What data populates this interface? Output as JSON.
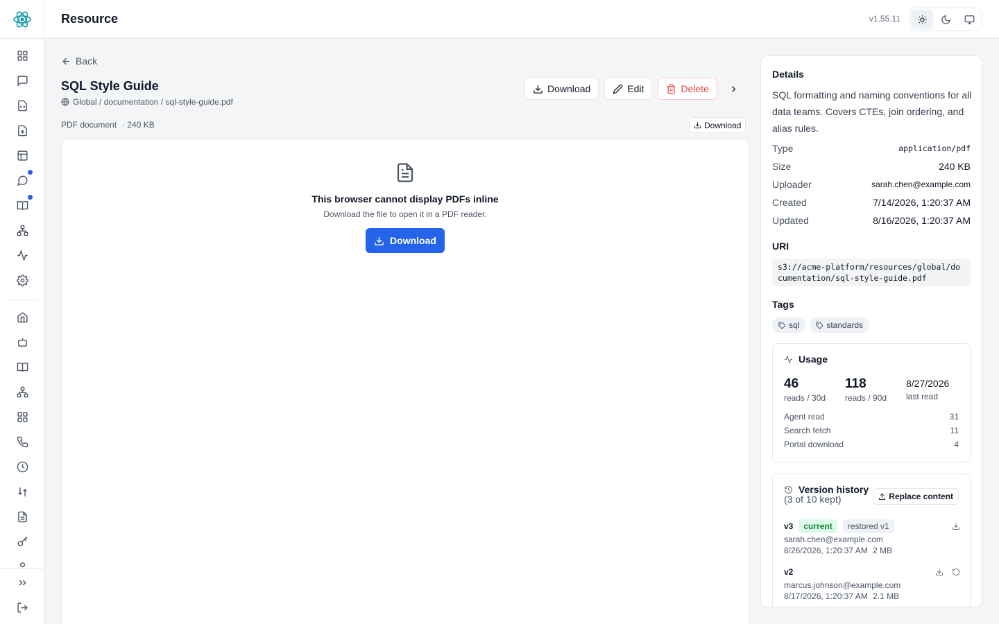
{
  "app": {
    "page_title": "Resource",
    "version": "v1.55.11"
  },
  "theme": {
    "options": [
      "light",
      "dark",
      "system"
    ],
    "active": "light"
  },
  "sidebar": {
    "top_icons": [
      "dashboard-icon",
      "chat-icon",
      "code-file-icon",
      "upload-file-icon",
      "table-icon",
      "message-icon",
      "book-icon",
      "hierarchy-icon",
      "activity-icon",
      "settings-icon"
    ],
    "badged": [
      "message-icon",
      "book-icon"
    ],
    "bottom_icons": [
      "home-icon",
      "bot-icon",
      "book-open-icon",
      "network-icon",
      "apps-icon",
      "phone-icon",
      "clock-icon",
      "compare-icon",
      "document-icon",
      "key-icon"
    ],
    "footer_icons": [
      "expand-icon",
      "logout-icon"
    ]
  },
  "header": {
    "back_label": "Back",
    "title": "SQL Style Guide",
    "path": "Global / documentation / sql-style-guide.pdf",
    "actions": {
      "download": "Download",
      "edit": "Edit",
      "delete": "Delete"
    }
  },
  "file_meta": {
    "kind": "PDF document",
    "size": "· 240 KB",
    "download_label": "Download"
  },
  "viewer": {
    "title": "This browser cannot display PDFs inline",
    "subtitle": "Download the file to open it in a PDF reader.",
    "button": "Download"
  },
  "details": {
    "heading": "Details",
    "description": "SQL formatting and naming conventions for all data teams. Covers CTEs, join ordering, and alias rules.",
    "fields": [
      {
        "label": "Type",
        "value": "application/pdf"
      },
      {
        "label": "Size",
        "value": "240 KB"
      },
      {
        "label": "Uploader",
        "value": "sarah.chen@example.com"
      },
      {
        "label": "Created",
        "value": "7/14/2026, 1:20:37 AM"
      },
      {
        "label": "Updated",
        "value": "8/16/2026, 1:20:37 AM"
      }
    ],
    "uri_heading": "URI",
    "uri": "s3://acme-platform/resources/global/documentation/sql-style-guide.pdf",
    "tags_heading": "Tags",
    "tags": [
      "sql",
      "standards"
    ]
  },
  "usage": {
    "heading": "Usage",
    "stats": [
      {
        "value": "46",
        "label": "reads / 30d"
      },
      {
        "value": "118",
        "label": "reads / 90d"
      },
      {
        "value": "8/27/2026",
        "label": "last read"
      }
    ],
    "breakdown": [
      {
        "label": "Agent read",
        "value": "31"
      },
      {
        "label": "Search fetch",
        "value": "11"
      },
      {
        "label": "Portal download",
        "value": "4"
      }
    ]
  },
  "versions": {
    "heading": "Version history",
    "subheading": "(3 of 10 kept)",
    "replace_label": "Replace content",
    "items": [
      {
        "version": "v3",
        "badge_current": "current",
        "badge_note": "restored v1",
        "user": "sarah.chen@example.com",
        "date": "8/26/2026, 1:20:37 AM",
        "size": "2 MB"
      },
      {
        "version": "v2",
        "user": "marcus.johnson@example.com",
        "date": "8/17/2026, 1:20:37 AM",
        "size": "2.1 MB"
      }
    ]
  }
}
